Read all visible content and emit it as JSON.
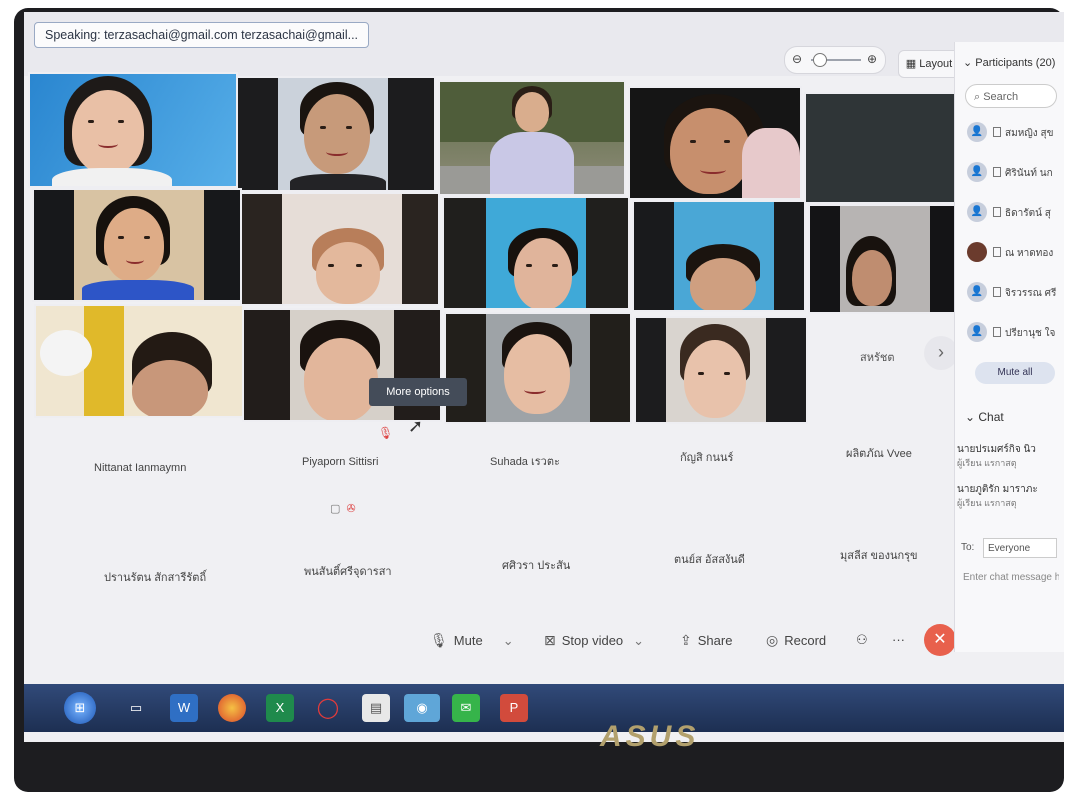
{
  "speaking": "Speaking: terzasachai@gmail.com terzasachai@gmail...",
  "zoom": {
    "minus_icon": "zoom-out-icon",
    "plus_icon": "zoom-in-icon"
  },
  "layout_label": "Layout",
  "tooltip": "More options",
  "grid_more_name": "สหรัชต",
  "participants_panel": {
    "title": "Participants (20)",
    "search_placeholder": "Search",
    "items": [
      "สมหญิง สุข",
      "ศิรินันท์ นก",
      "ธิดารัตน์ สุ",
      "ณ หาดทอง",
      "จิรวรรณ ศรี",
      "ปรียานุช ใจ"
    ],
    "mute_all": "Mute all"
  },
  "chat": {
    "title": "Chat",
    "messages": [
      {
        "from": "นายปรเมศร์กิจ นิว",
        "text": "ผู้เรียน แรกาสตุ"
      },
      {
        "from": "นายภูติรัก มาราภะ",
        "text": "ผู้เรียน แรกาสตุ"
      }
    ],
    "to_label": "To:",
    "to_value": "Everyone",
    "input_placeholder": "Enter chat message here"
  },
  "no_video_names": [
    "Nittanat Ianmaymn",
    "Piyaporn Sittisri",
    "Suhada เรวตะ",
    "กัญสิ กนนร์",
    "ผลิตภัณ Vvee",
    "ปรานรัตน สักสารีรัตถิ์",
    "พนสันติ์ศรีจุดารสา",
    "ศศิวรา ประสัน",
    "ตนย์ส อัสสงันดี",
    "มุสลีส ของนกรุข"
  ],
  "controls": {
    "mute": "Mute",
    "stop_video": "Stop video",
    "share": "Share",
    "record": "Record"
  },
  "brand": "ASUS",
  "colors": {
    "end_meeting": "#e8604c",
    "taskbar": "#24385f"
  }
}
